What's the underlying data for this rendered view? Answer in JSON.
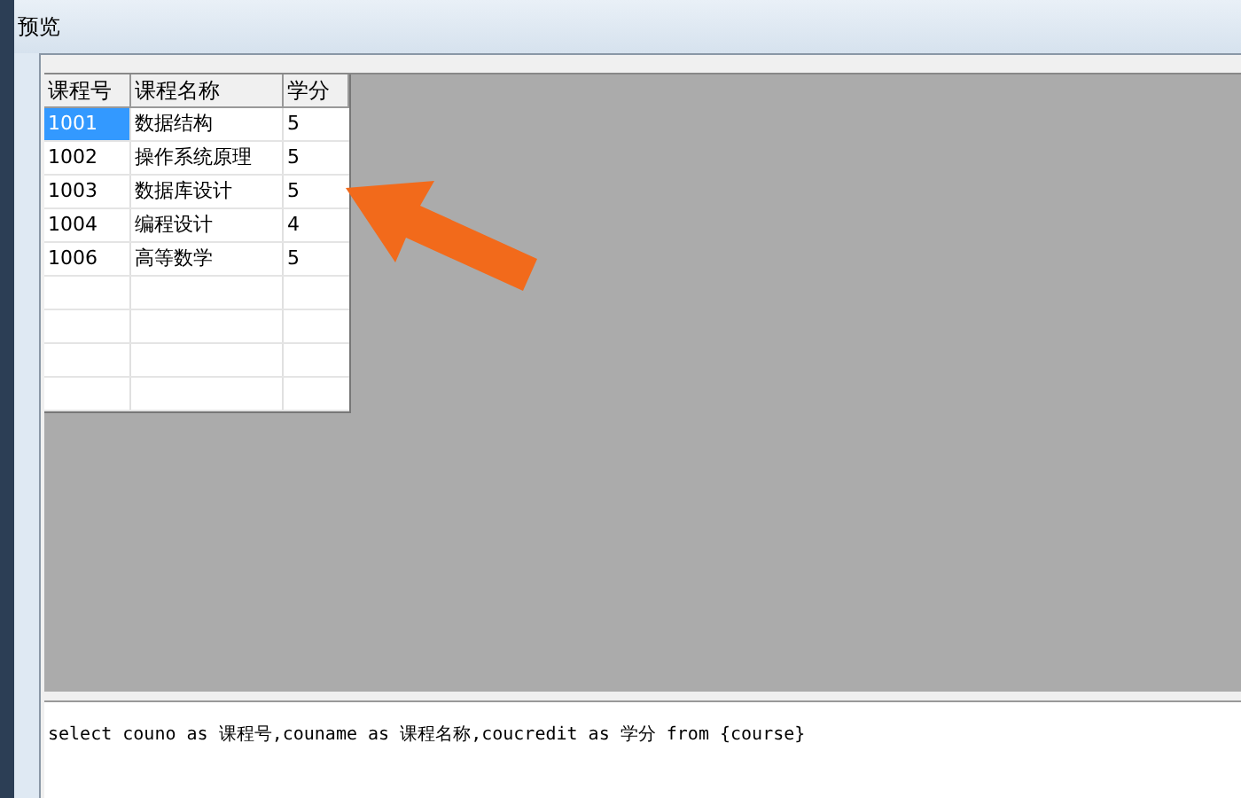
{
  "window": {
    "title": "预览"
  },
  "table": {
    "columns": [
      "课程号",
      "课程名称",
      "学分"
    ],
    "rows": [
      {
        "cells": [
          "1001",
          "数据结构",
          "5"
        ],
        "selected": true
      },
      {
        "cells": [
          "1002",
          "操作系统原理",
          "5"
        ],
        "selected": false
      },
      {
        "cells": [
          "1003",
          "数据库设计",
          "5"
        ],
        "selected": false
      },
      {
        "cells": [
          "1004",
          "编程设计",
          "4"
        ],
        "selected": false
      },
      {
        "cells": [
          "1006",
          "高等数学",
          "5"
        ],
        "selected": false
      }
    ]
  },
  "sql_editor": {
    "value": "select couno as 课程号,couname as 课程名称,coucredit as 学分 from {course}"
  }
}
